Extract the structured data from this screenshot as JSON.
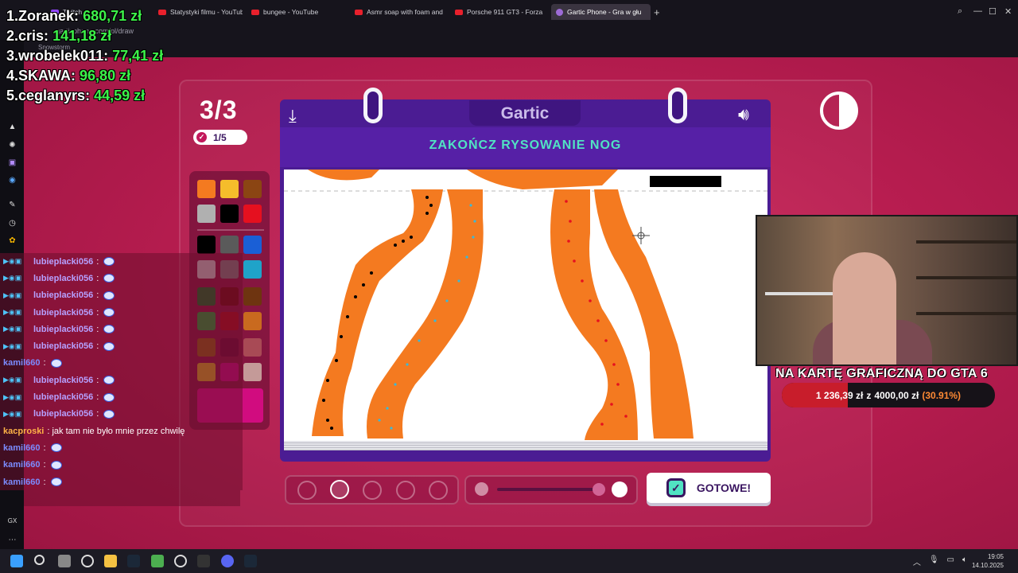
{
  "browser": {
    "tabs": [
      {
        "label": "Twitch",
        "type": "twitch"
      },
      {
        "label": "Statystyki filmu - YouTube",
        "type": "yt"
      },
      {
        "label": "bungee - YouTube",
        "type": "yt"
      },
      {
        "label": "Asmr soap with foam and",
        "type": "yt"
      },
      {
        "label": "Porsche 911 GT3 - Forza",
        "type": "yt"
      },
      {
        "label": "Gartic Phone - Gra w głu",
        "type": "gartic"
      }
    ],
    "url": "garticphone.com/pl/draw",
    "bookmark": "Snowstorm"
  },
  "donors": [
    {
      "rank": "1.",
      "name": "Zoranek:",
      "amount": "680,71 zł"
    },
    {
      "rank": "2.",
      "name": "cris:",
      "amount": "141,18 zł"
    },
    {
      "rank": "3.",
      "name": "wrobelek011:",
      "amount": "77,41 zł"
    },
    {
      "rank": "4.",
      "name": "SKAWA:",
      "amount": "96,80 zł"
    },
    {
      "rank": "5.",
      "name": "ceglanyrs:",
      "amount": "44,59 zł"
    }
  ],
  "game": {
    "round": "3/3",
    "done_count": "1/5",
    "logo": "Gartic",
    "prompt": "ZAKOŃCZ RYSOWANIE NOG",
    "done_button": "GOTOWE!",
    "colors": {
      "accent": "#51e3c3",
      "book": "#4b1c93",
      "background": "#b81d50",
      "selected_color": "#d10c7f"
    },
    "palette": [
      "#f47a20",
      "#f5bd2b",
      "#8b4513",
      "#b0b0b0",
      "#000000",
      "#e5101f",
      "#000000",
      "#5a5a5a",
      "#1a5fd6",
      "#c0c0c0",
      "#7a7a7a",
      "#1fa3c9",
      "#0c6b23",
      "#6b0a10",
      "#6e3410",
      "#1d9a34",
      "#a40d1a",
      "#c96a1f",
      "#8c5a10",
      "#6b0a36",
      "#a84a55",
      "#c9a31f",
      "#c20a7b",
      "#c49a98"
    ]
  },
  "chat": [
    {
      "user": "lubieplacki056",
      "msg": ":",
      "style": "sub"
    },
    {
      "user": "lubieplacki056",
      "msg": ":",
      "style": "sub"
    },
    {
      "user": "lubieplacki056",
      "msg": ":",
      "style": "sub"
    },
    {
      "user": "lubieplacki056",
      "msg": ":",
      "style": "sub"
    },
    {
      "user": "lubieplacki056",
      "msg": ":",
      "style": "sub"
    },
    {
      "user": "lubieplacki056",
      "msg": ":",
      "style": "sub"
    },
    {
      "user": "kamil660",
      "msg": ":",
      "style": "k"
    },
    {
      "user": "lubieplacki056",
      "msg": ":",
      "style": "sub"
    },
    {
      "user": "lubieplacki056",
      "msg": ":",
      "style": "sub"
    },
    {
      "user": "lubieplacki056",
      "msg": ":",
      "style": "sub"
    },
    {
      "user": "kacproski",
      "msg": ": jak tam nie było mnie przez chwilę",
      "style": "kc"
    },
    {
      "user": "kamil660",
      "msg": ":",
      "style": "k"
    },
    {
      "user": "kamil660",
      "msg": ":",
      "style": "k"
    },
    {
      "user": "kamil660",
      "msg": ":",
      "style": "k"
    }
  ],
  "goal": {
    "title": "NA KARTĘ GRAFICZNĄ DO GTA 6",
    "current": "1 236,39 zł",
    "sep": "z",
    "target": "4000,00 zł",
    "percent_label": "(30.91%)",
    "progress": 0.3091
  },
  "taskbar": {
    "time": "19:05",
    "date": "14.10.2025"
  }
}
